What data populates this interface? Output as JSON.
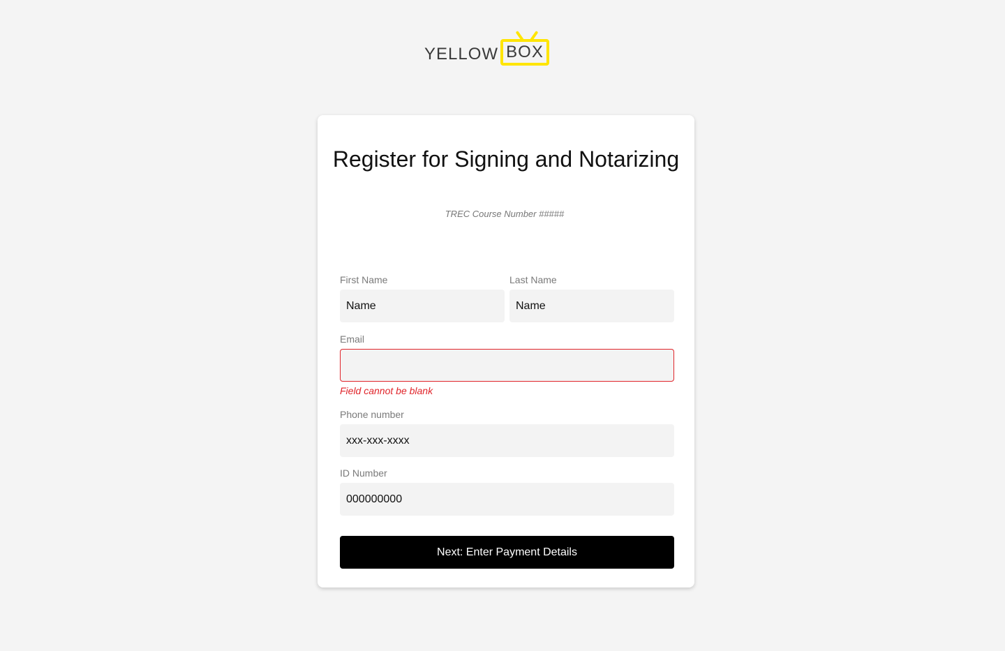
{
  "logo": {
    "word": "YELLOW",
    "box_text": "BOX"
  },
  "form": {
    "title": "Register for Signing and Notarizing",
    "subtitle": "TREC Course Number #####",
    "first_name": {
      "label": "First Name",
      "placeholder": "Name",
      "value": ""
    },
    "last_name": {
      "label": "Last Name",
      "placeholder": "Name",
      "value": ""
    },
    "email": {
      "label": "Email",
      "placeholder": "",
      "value": "",
      "error": "Field cannot be blank"
    },
    "phone": {
      "label": "Phone number",
      "placeholder": "xxx-xxx-xxxx",
      "value": ""
    },
    "id_number": {
      "label": "ID Number",
      "placeholder": "000000000",
      "value": ""
    },
    "submit_label": "Next: Enter Payment Details"
  },
  "colors": {
    "background": "#f4f4f4",
    "brand_yellow": "#ffe500",
    "error_red": "#e0242a",
    "button": "#000000"
  }
}
